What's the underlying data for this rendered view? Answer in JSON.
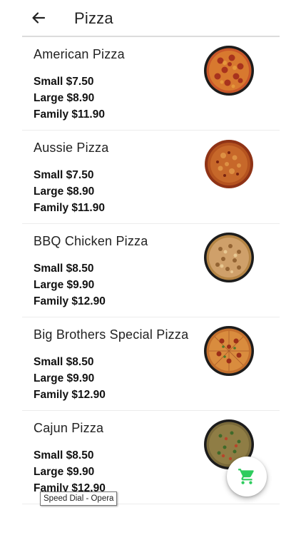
{
  "header": {
    "title": "Pizza",
    "back_icon": "arrow-left-icon"
  },
  "items": [
    {
      "name": "American Pizza",
      "prices": [
        "Small $7.50",
        "Large $8.90",
        "Family $11.90"
      ],
      "image": "pepperoni-pizza"
    },
    {
      "name": "Aussie Pizza",
      "prices": [
        "Small $7.50",
        "Large $8.90",
        "Family $11.90"
      ],
      "image": "aussie-pizza"
    },
    {
      "name": "BBQ Chicken Pizza",
      "prices": [
        "Small $8.50",
        "Large $9.90",
        "Family $12.90"
      ],
      "image": "bbq-chicken-pizza"
    },
    {
      "name": "Big Brothers Special Pizza",
      "prices": [
        "Small $8.50",
        "Large $9.90",
        "Family $12.90"
      ],
      "image": "special-pizza"
    },
    {
      "name": "Cajun Pizza",
      "prices": [
        "Small $8.50",
        "Large $9.90",
        "Family $12.90"
      ],
      "image": "cajun-pizza"
    }
  ],
  "cart": {
    "icon": "cart-icon",
    "color": "#2ecc5e"
  },
  "tooltip": {
    "text": "Speed Dial - Opera"
  }
}
